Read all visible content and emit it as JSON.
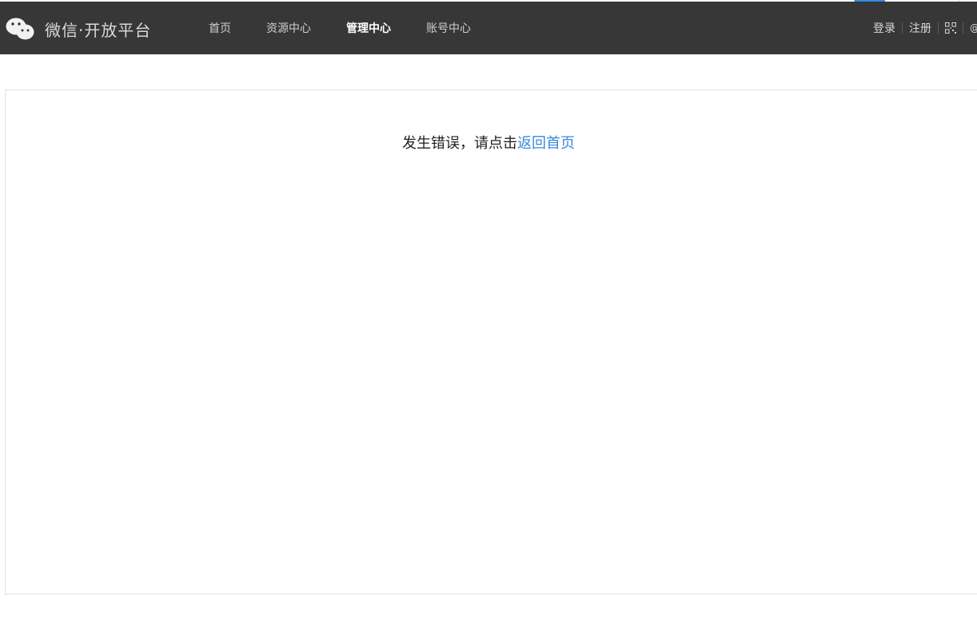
{
  "header": {
    "brand": "微信·开放平台",
    "nav": [
      {
        "label": "首页",
        "active": false
      },
      {
        "label": "资源中心",
        "active": false
      },
      {
        "label": "管理中心",
        "active": true
      },
      {
        "label": "账号中心",
        "active": false
      }
    ],
    "login": "登录",
    "register": "注册",
    "at_symbol": "@",
    "icons": {
      "logo": "wechat-logo-icon",
      "qr": "qr-code-icon"
    },
    "colors": {
      "background": "#373737",
      "text": "#d9d9d9",
      "active_text": "#ffffff"
    }
  },
  "main": {
    "error_text": "发生错误，请点击",
    "home_link": "返回首页",
    "link_color": "#3b88d8"
  }
}
